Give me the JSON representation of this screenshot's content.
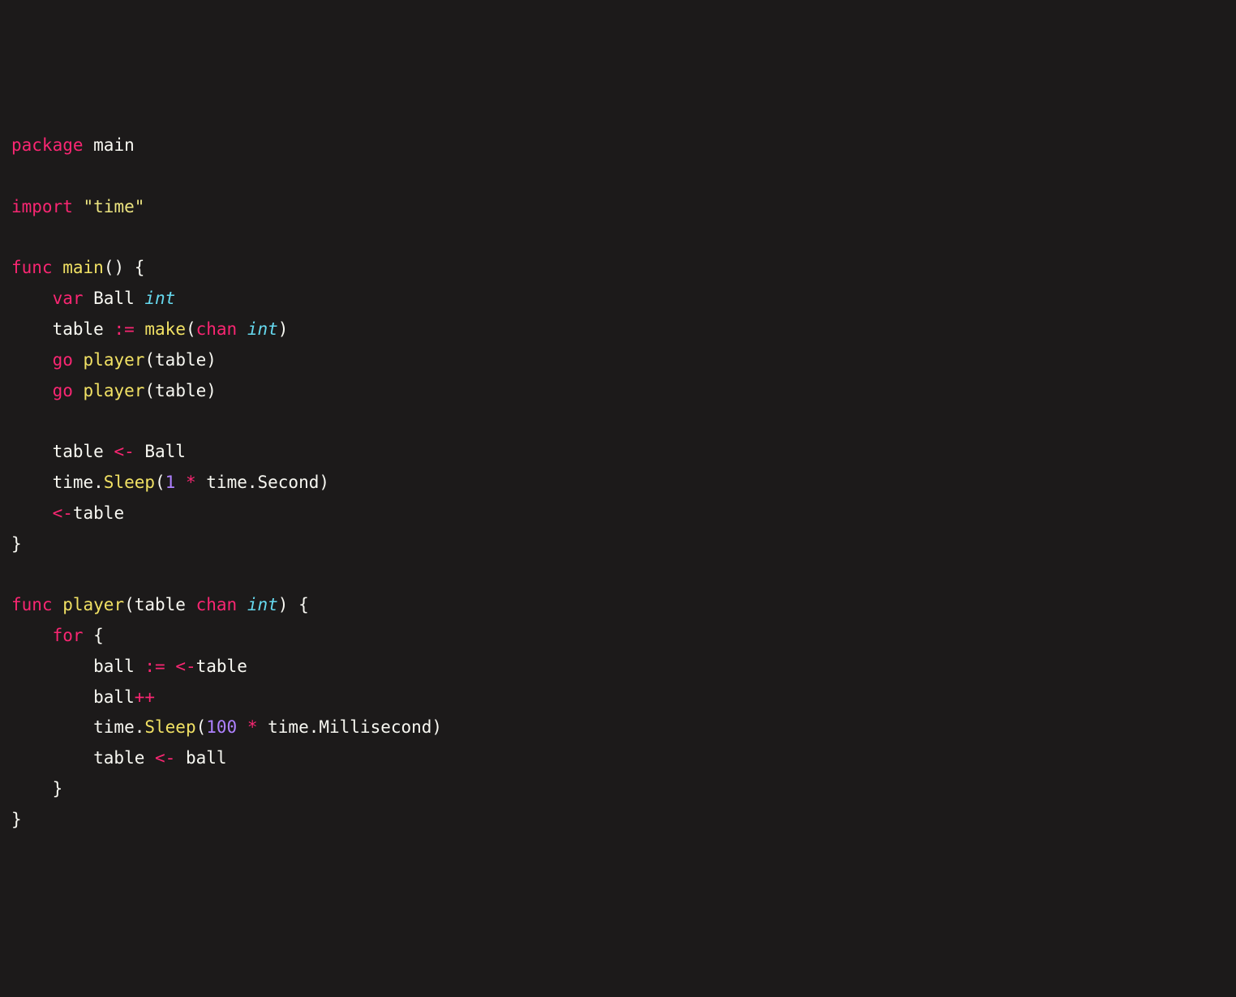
{
  "code": {
    "tokens": [
      [
        {
          "c": "kw",
          "t": "package"
        },
        {
          "c": "id",
          "t": " main"
        }
      ],
      [],
      [
        {
          "c": "kw",
          "t": "import"
        },
        {
          "c": "id",
          "t": " "
        },
        {
          "c": "str",
          "t": "\"time\""
        }
      ],
      [],
      [
        {
          "c": "kw",
          "t": "func"
        },
        {
          "c": "id",
          "t": " "
        },
        {
          "c": "fn",
          "t": "main"
        },
        {
          "c": "pn",
          "t": "() {"
        }
      ],
      [
        {
          "c": "id",
          "t": "    "
        },
        {
          "c": "kw",
          "t": "var"
        },
        {
          "c": "id",
          "t": " Ball "
        },
        {
          "c": "type",
          "t": "int"
        }
      ],
      [
        {
          "c": "id",
          "t": "    table "
        },
        {
          "c": "op",
          "t": ":="
        },
        {
          "c": "id",
          "t": " "
        },
        {
          "c": "fn",
          "t": "make"
        },
        {
          "c": "pn",
          "t": "("
        },
        {
          "c": "kw",
          "t": "chan"
        },
        {
          "c": "id",
          "t": " "
        },
        {
          "c": "type",
          "t": "int"
        },
        {
          "c": "pn",
          "t": ")"
        }
      ],
      [
        {
          "c": "id",
          "t": "    "
        },
        {
          "c": "kw",
          "t": "go"
        },
        {
          "c": "id",
          "t": " "
        },
        {
          "c": "fn",
          "t": "player"
        },
        {
          "c": "pn",
          "t": "(table)"
        }
      ],
      [
        {
          "c": "id",
          "t": "    "
        },
        {
          "c": "kw",
          "t": "go"
        },
        {
          "c": "id",
          "t": " "
        },
        {
          "c": "fn",
          "t": "player"
        },
        {
          "c": "pn",
          "t": "(table)"
        }
      ],
      [],
      [
        {
          "c": "id",
          "t": "    table "
        },
        {
          "c": "op",
          "t": "<-"
        },
        {
          "c": "id",
          "t": " Ball"
        }
      ],
      [
        {
          "c": "id",
          "t": "    time."
        },
        {
          "c": "fn",
          "t": "Sleep"
        },
        {
          "c": "pn",
          "t": "("
        },
        {
          "c": "num",
          "t": "1"
        },
        {
          "c": "id",
          "t": " "
        },
        {
          "c": "op",
          "t": "*"
        },
        {
          "c": "id",
          "t": " time.Second)"
        }
      ],
      [
        {
          "c": "id",
          "t": "    "
        },
        {
          "c": "op",
          "t": "<-"
        },
        {
          "c": "id",
          "t": "table"
        }
      ],
      [
        {
          "c": "pn",
          "t": "}"
        }
      ],
      [],
      [
        {
          "c": "kw",
          "t": "func"
        },
        {
          "c": "id",
          "t": " "
        },
        {
          "c": "fn",
          "t": "player"
        },
        {
          "c": "pn",
          "t": "(table "
        },
        {
          "c": "kw",
          "t": "chan"
        },
        {
          "c": "id",
          "t": " "
        },
        {
          "c": "type",
          "t": "int"
        },
        {
          "c": "pn",
          "t": ") {"
        }
      ],
      [
        {
          "c": "id",
          "t": "    "
        },
        {
          "c": "kw",
          "t": "for"
        },
        {
          "c": "pn",
          "t": " {"
        }
      ],
      [
        {
          "c": "id",
          "t": "        ball "
        },
        {
          "c": "op",
          "t": ":="
        },
        {
          "c": "id",
          "t": " "
        },
        {
          "c": "op",
          "t": "<-"
        },
        {
          "c": "id",
          "t": "table"
        }
      ],
      [
        {
          "c": "id",
          "t": "        ball"
        },
        {
          "c": "op",
          "t": "++"
        }
      ],
      [
        {
          "c": "id",
          "t": "        time."
        },
        {
          "c": "fn",
          "t": "Sleep"
        },
        {
          "c": "pn",
          "t": "("
        },
        {
          "c": "num",
          "t": "100"
        },
        {
          "c": "id",
          "t": " "
        },
        {
          "c": "op",
          "t": "*"
        },
        {
          "c": "id",
          "t": " time.Millisecond)"
        }
      ],
      [
        {
          "c": "id",
          "t": "        table "
        },
        {
          "c": "op",
          "t": "<-"
        },
        {
          "c": "id",
          "t": " ball"
        }
      ],
      [
        {
          "c": "id",
          "t": "    "
        },
        {
          "c": "pn",
          "t": "}"
        }
      ],
      [
        {
          "c": "pn",
          "t": "}"
        }
      ]
    ]
  }
}
